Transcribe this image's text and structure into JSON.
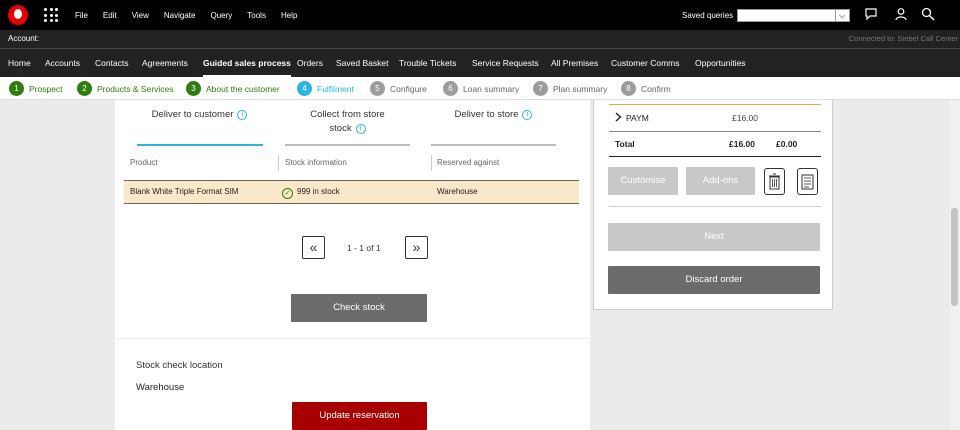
{
  "menu": {
    "items": [
      "File",
      "Edit",
      "View",
      "Navigate",
      "Query",
      "Tools",
      "Help"
    ],
    "saved_queries_label": "Saved queries",
    "saved_queries_value": ""
  },
  "account_bar": {
    "account_label": "Account:",
    "connection_status": "Connected to: Siebel Call Center"
  },
  "tabs": [
    {
      "label": "Home"
    },
    {
      "label": "Accounts"
    },
    {
      "label": "Contacts"
    },
    {
      "label": "Agreements"
    },
    {
      "label": "Guided sales process",
      "active": true
    },
    {
      "label": "Orders"
    },
    {
      "label": "Saved Basket"
    },
    {
      "label": "Trouble Tickets"
    },
    {
      "label": "Service Requests"
    },
    {
      "label": "All Premises"
    },
    {
      "label": "Customer Comms"
    },
    {
      "label": "Opportunities"
    }
  ],
  "steps": [
    {
      "num": "1",
      "label": "Prospect",
      "state": "done"
    },
    {
      "num": "2",
      "label": "Products & Services",
      "state": "done"
    },
    {
      "num": "3",
      "label": "About the customer",
      "state": "done"
    },
    {
      "num": "4",
      "label": "Fulfilment",
      "state": "current"
    },
    {
      "num": "5",
      "label": "Configure",
      "state": "todo"
    },
    {
      "num": "6",
      "label": "Loan summary",
      "state": "todo"
    },
    {
      "num": "7",
      "label": "Plan summary",
      "state": "todo"
    },
    {
      "num": "8",
      "label": "Confirm",
      "state": "todo"
    }
  ],
  "delivery_tabs": {
    "deliver_to_customer": "Deliver to customer",
    "collect_from_store_line1": "Collect from store",
    "collect_from_store_line2": "stock",
    "deliver_to_store": "Deliver to store",
    "info_glyph": "i"
  },
  "table": {
    "headers": [
      "Product",
      "Stock information",
      "Reserved against"
    ],
    "rows": [
      {
        "product": "Blank White Triple Format SIM",
        "stock": "999 in stock",
        "reserved": "Warehouse"
      }
    ]
  },
  "pager": {
    "prev_glyph": "«",
    "next_glyph": "»",
    "text": "1 - 1 of 1"
  },
  "buttons": {
    "check_stock": "Check stock",
    "update_reservation": "Update reservation",
    "customise": "Customise",
    "add_ons": "Add-ons",
    "next": "Next",
    "discard_order": "Discard order"
  },
  "stock_location": {
    "label": "Stock check location",
    "value": "Warehouse"
  },
  "summary": {
    "paym_label": "PAYM",
    "paym_value": "£16.00",
    "total_label": "Total",
    "total_monthly": "£16.00",
    "total_upfront": "£0.00"
  },
  "colors": {
    "brand_red": "#e60000",
    "step_done": "#2e7d0f",
    "step_current": "#2bb4e0",
    "reserve_button": "#a80000"
  }
}
